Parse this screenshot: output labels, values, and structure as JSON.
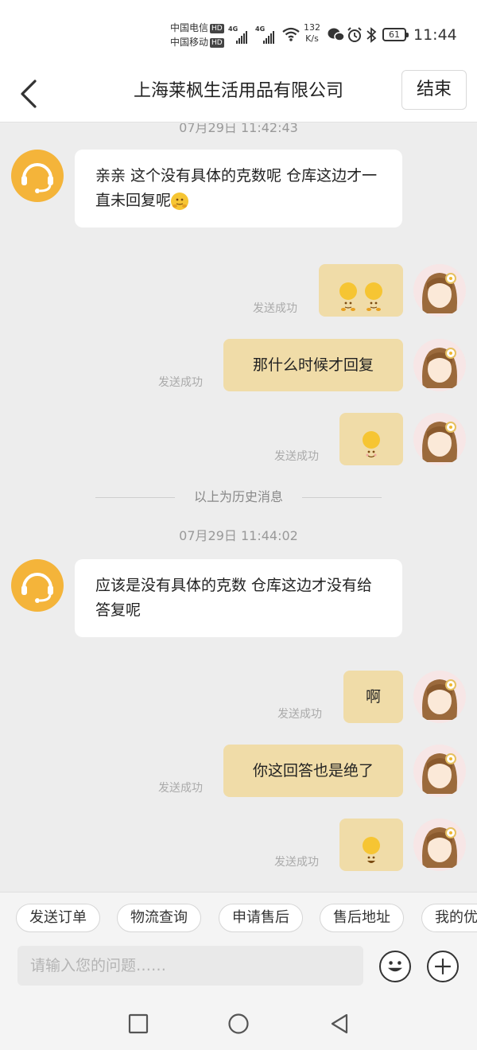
{
  "status": {
    "carrier1": "中国电信",
    "carrier2": "中国移动",
    "hd": "HD",
    "net1": "4G",
    "net2": "4G",
    "speed_value": "132",
    "speed_unit": "K/s",
    "battery": "61",
    "time": "11:44"
  },
  "header": {
    "title": "上海莱枫生活用品有限公司",
    "end_label": "结束"
  },
  "chat": {
    "top_timestamp": "07月29日 11:42:43",
    "messages_part1": [
      {
        "from": "agent",
        "text": "亲亲 这个没有具体的克数呢 仓库这边才一直未回复呢",
        "emoji": "hug-emoji"
      },
      {
        "from": "me",
        "emoji_count": 2,
        "emoji": "hug-emoji",
        "status": "发送成功"
      },
      {
        "from": "me",
        "text": "那什么时候才回复",
        "status": "发送成功"
      },
      {
        "from": "me",
        "emoji": "smile-emoji",
        "status": "发送成功"
      }
    ],
    "history_divider": "以上为历史消息",
    "second_timestamp": "07月29日 11:44:02",
    "messages_part2": [
      {
        "from": "agent",
        "text": "应该是没有具体的克数 仓库这边才没有给答复呢"
      },
      {
        "from": "me",
        "text": "啊",
        "status": "发送成功"
      },
      {
        "from": "me",
        "text": "你这回答也是绝了",
        "status": "发送成功"
      },
      {
        "from": "me",
        "emoji": "grin-emoji",
        "status": "发送成功"
      }
    ]
  },
  "quick_actions": [
    "发送订单",
    "物流查询",
    "申请售后",
    "售后地址",
    "我的优"
  ],
  "input": {
    "placeholder": "请输入您的问题……"
  }
}
